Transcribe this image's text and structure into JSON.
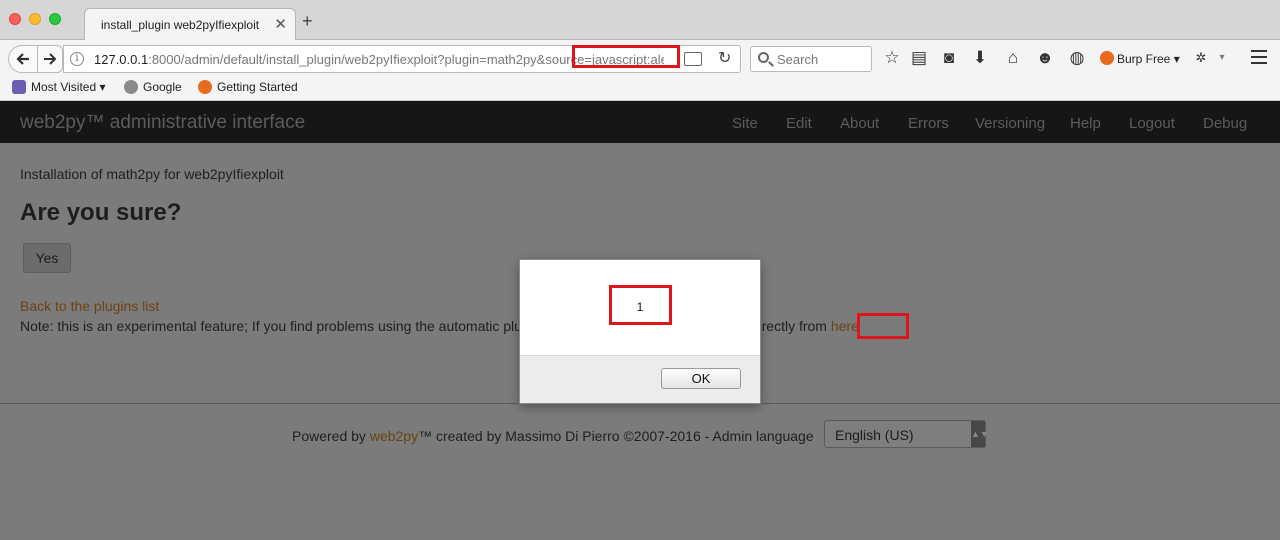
{
  "browser": {
    "tab_title": "install_plugin web2pyIfiexploit",
    "tab_close": "✕",
    "new_tab": "+",
    "url_host": "127.0.0.1",
    "url_rest": ":8000/admin/default/install_plugin/web2pyIfiexploit?plugin=math2py&source=javascript:aler",
    "search_placeholder": "Search",
    "burp_label": "Burp Free",
    "bookmarks": [
      "Most Visited",
      "Google",
      "Getting Started"
    ],
    "icons": [
      "back-icon",
      "forward-icon",
      "info-icon",
      "reader-view-icon",
      "reload-icon",
      "search-icon",
      "bookmark-star-icon",
      "reading-list-icon",
      "pocket-icon",
      "download-icon",
      "home-icon",
      "emoji-icon",
      "globe-icon",
      "burp-icon",
      "extension-icon",
      "menu-icon"
    ]
  },
  "app": {
    "brand": "web2py™ administrative interface",
    "nav": [
      "Site",
      "Edit",
      "About",
      "Errors",
      "Versioning",
      "Help",
      "Logout",
      "Debug"
    ]
  },
  "content": {
    "intro": "Installation of math2py for web2pyIfiexploit",
    "heading": "Are you sure?",
    "yes_button": "Yes",
    "back_link": "Back to the plugins list",
    "note_prefix": "Note: this is an experimental feature; If you find problems using the automatic plugin installation, try using the installer directly from ",
    "note_link": "here"
  },
  "footer": {
    "powered_by": "Powered by ",
    "web2py_link": "web2py",
    "credits": "™ created by Massimo Di Pierro ©2007-2016 - Admin language",
    "language": "English (US)"
  },
  "dialog": {
    "message": "1",
    "ok": "OK"
  },
  "colors": {
    "annotation": "#e0141c",
    "overlay": "#7b7b7b",
    "link": "#6a4412"
  }
}
